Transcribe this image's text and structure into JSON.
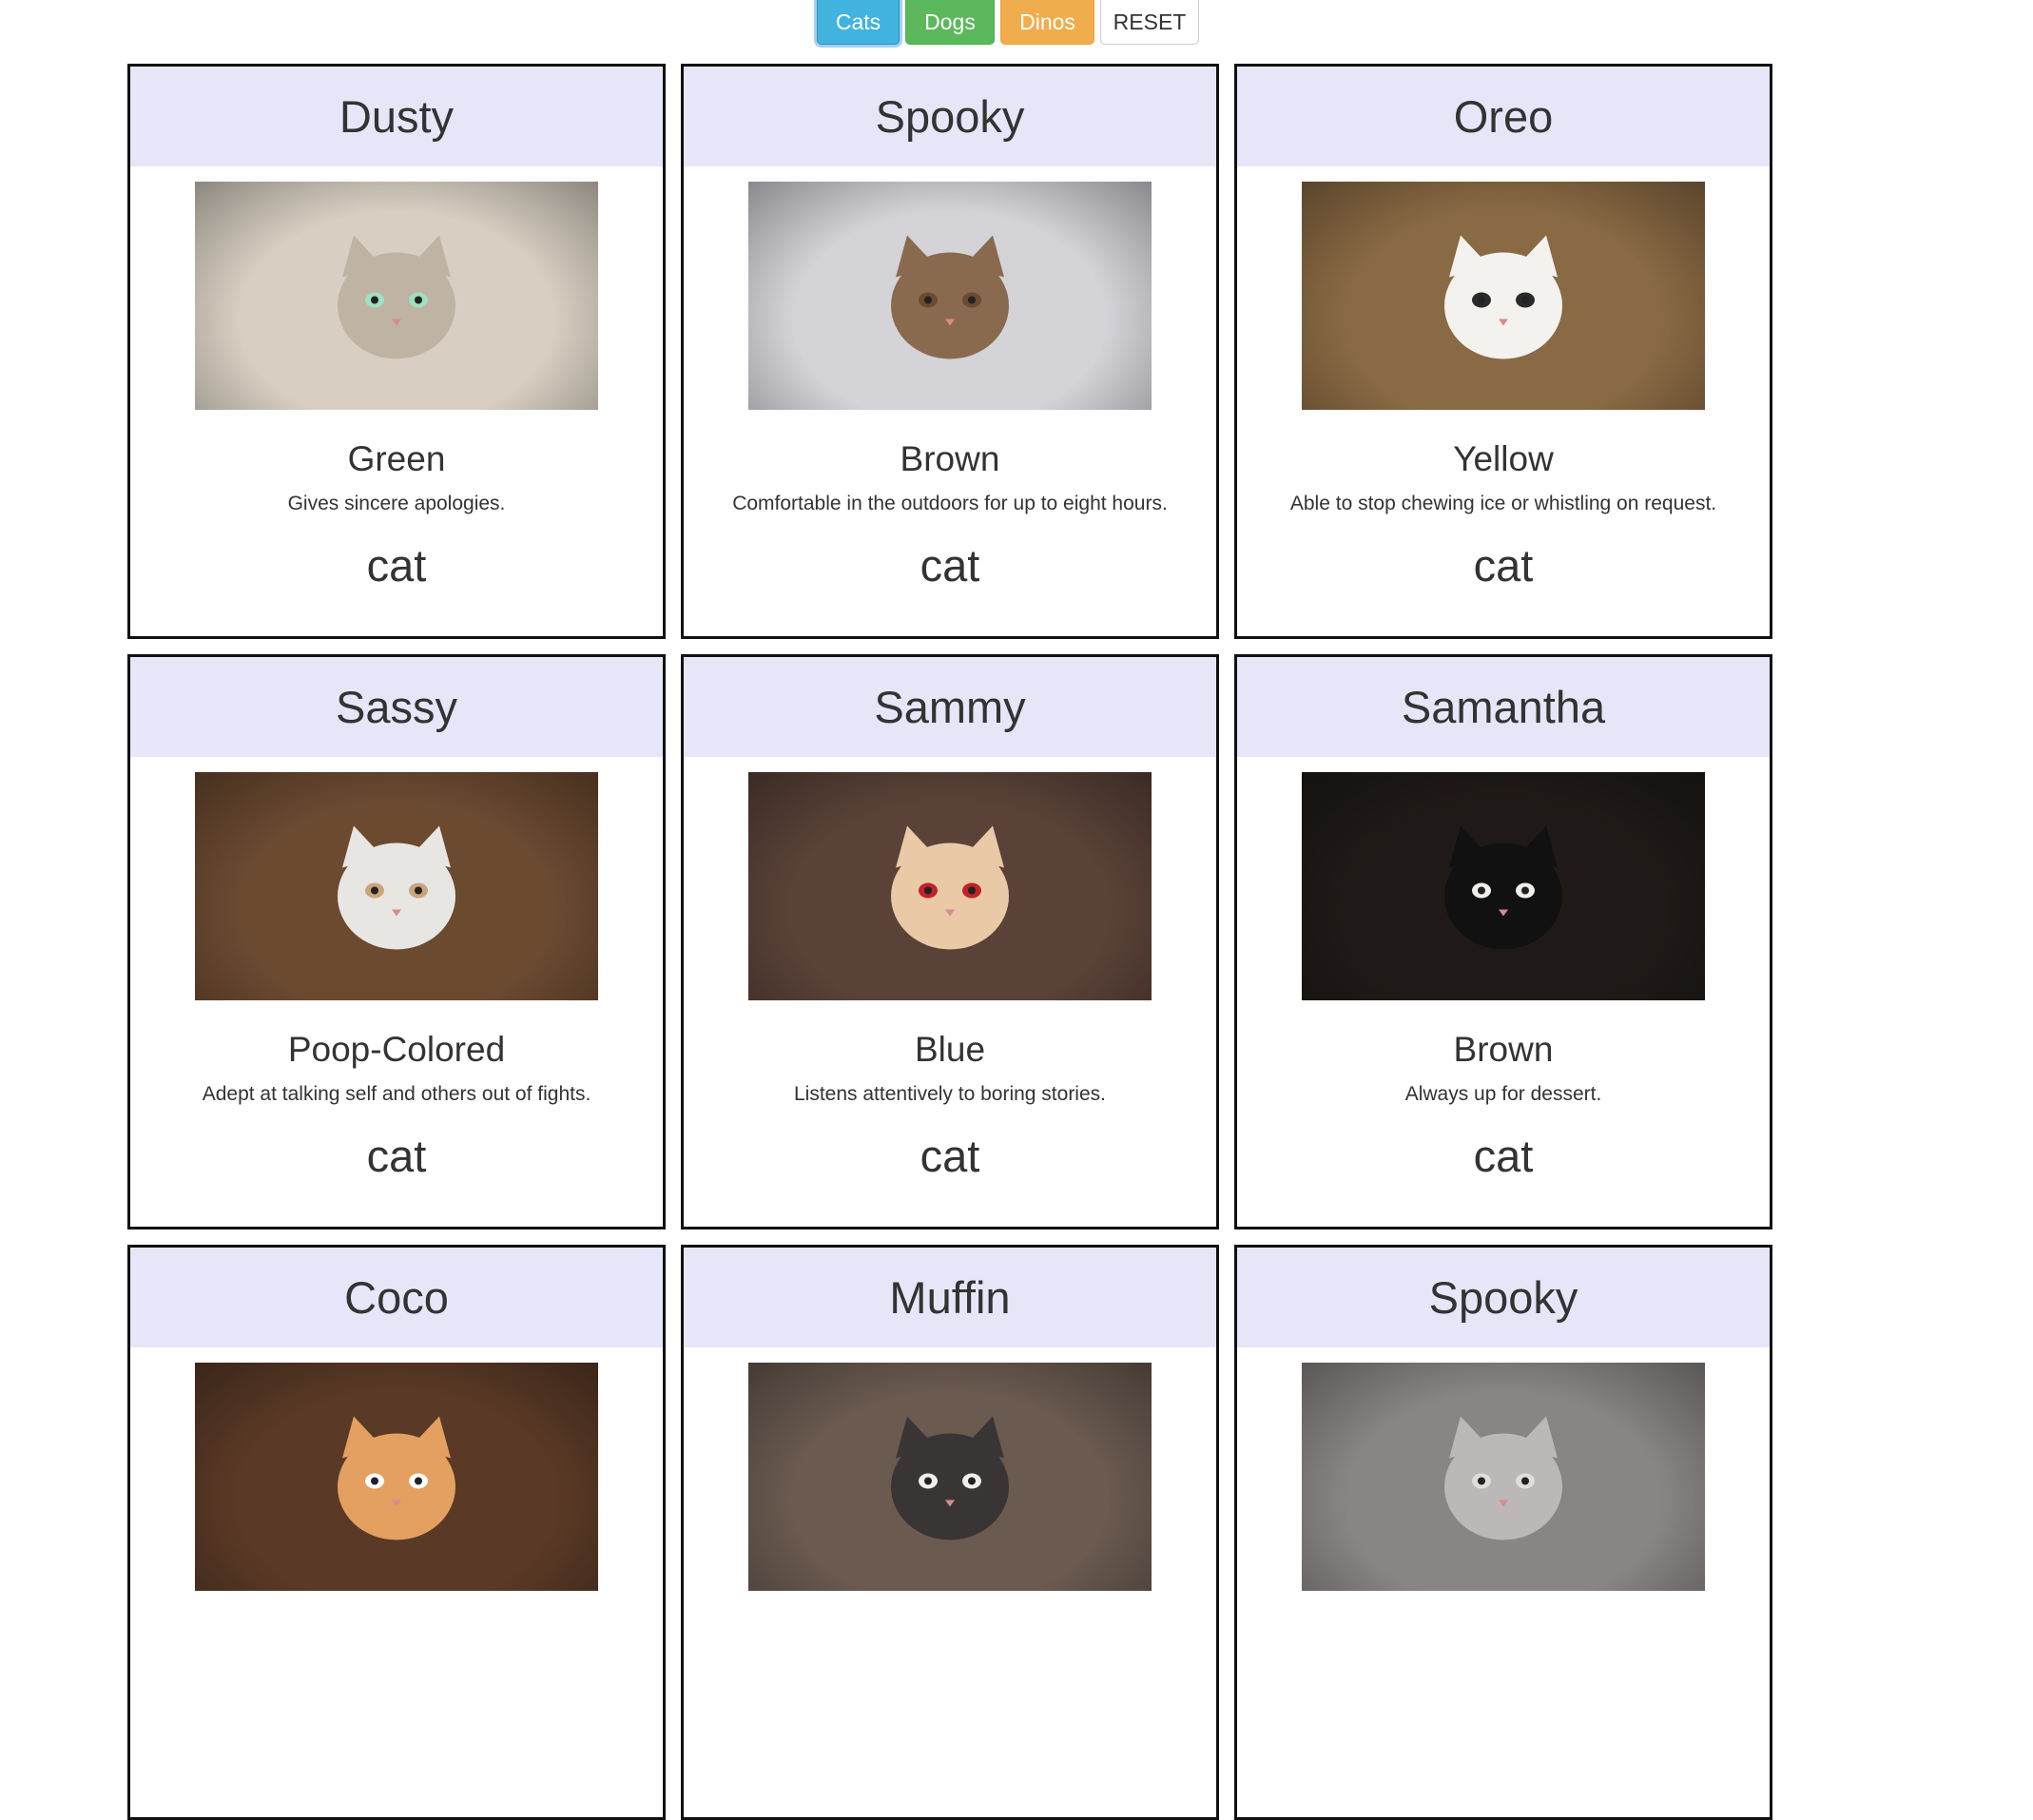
{
  "filters": {
    "cats": "Cats",
    "dogs": "Dogs",
    "dinos": "Dinos",
    "reset": "RESET"
  },
  "colors": {
    "header_bg": "#e6e6f8",
    "cats_btn": "#40b4df",
    "dogs_btn": "#5cb85c",
    "dinos_btn": "#f0ad4e"
  },
  "cards": [
    {
      "name": "Dusty",
      "color": "Green",
      "desc": "Gives sincere apologies.",
      "species": "cat",
      "photo_bg": "#d8cfc2",
      "cat_color": "#bfb3a3",
      "accent": "#9fe0c0"
    },
    {
      "name": "Spooky",
      "color": "Brown",
      "desc": "Comfortable in the outdoors for up to eight hours.",
      "species": "cat",
      "photo_bg": "#d3d3d8",
      "cat_color": "#8a6a4e",
      "accent": "#6b4b32"
    },
    {
      "name": "Oreo",
      "color": "Yellow",
      "desc": "Able to stop chewing ice or whistling on request.",
      "species": "cat",
      "photo_bg": "#8a6a44",
      "cat_color": "#f4f2ef",
      "accent": "#2a2a2a"
    },
    {
      "name": "Sassy",
      "color": "Poop-Colored",
      "desc": "Adept at talking self and others out of fights.",
      "species": "cat",
      "photo_bg": "#6b4a30",
      "cat_color": "#e8e6e2",
      "accent": "#c9a57a"
    },
    {
      "name": "Sammy",
      "color": "Blue",
      "desc": "Listens attentively to boring stories.",
      "species": "cat",
      "photo_bg": "#5a4238",
      "cat_color": "#e9c9a6",
      "accent": "#c0232a"
    },
    {
      "name": "Samantha",
      "color": "Brown",
      "desc": "Always up for dessert.",
      "species": "cat",
      "photo_bg": "#1f1a17",
      "cat_color": "#111111",
      "accent": "#f1efe9"
    },
    {
      "name": "Coco",
      "color": "",
      "desc": "",
      "species": "",
      "photo_bg": "#5a3a26",
      "cat_color": "#e3a060",
      "accent": "#ffffff"
    },
    {
      "name": "Muffin",
      "color": "",
      "desc": "",
      "species": "",
      "photo_bg": "#6a5a50",
      "cat_color": "#3a3535",
      "accent": "#f1efe9"
    },
    {
      "name": "Spooky",
      "color": "",
      "desc": "",
      "species": "",
      "photo_bg": "#8a8585",
      "cat_color": "#bcb8b8",
      "accent": "#e0dddd"
    }
  ]
}
